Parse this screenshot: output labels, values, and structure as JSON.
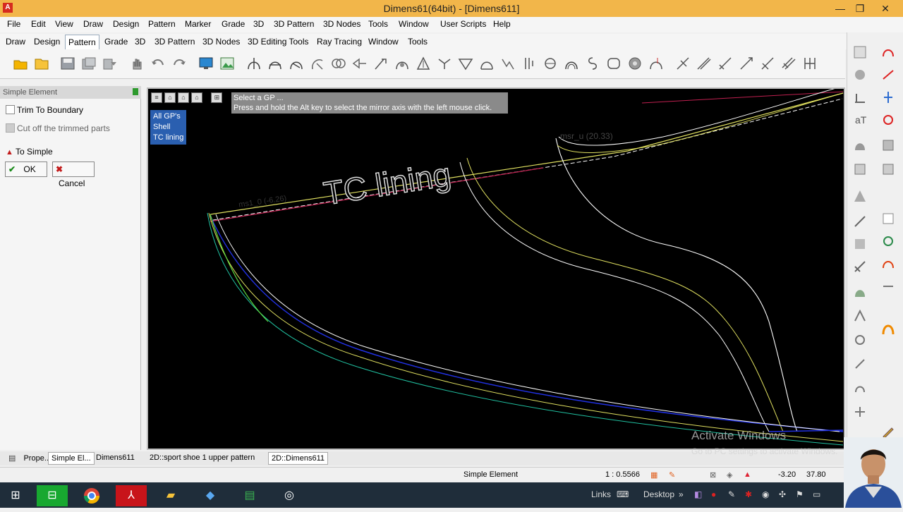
{
  "window": {
    "title": "Dimens61(64bit) - [Dimens611]",
    "min": "—",
    "max": "❐",
    "close": "✕"
  },
  "menu": [
    "File",
    "Edit",
    "View",
    "Draw",
    "Design",
    "Pattern",
    "Marker",
    "Grade",
    "3D",
    "3D Pattern",
    "3D Nodes",
    "Tools",
    "Window",
    "User Scripts",
    "Help"
  ],
  "tabs": [
    "Draw",
    "Design",
    "Pattern",
    "Grade",
    "3D",
    "3D Pattern",
    "3D Nodes",
    "3D Editing Tools",
    "Ray Tracing",
    "Window",
    "Tools"
  ],
  "active_tab": "Pattern",
  "panel": {
    "title": "Simple Element",
    "trim_label": "Trim To Boundary",
    "cut_label": "Cut off the trimmed parts",
    "to_simple": "To Simple",
    "ok": "OK",
    "cancel": "Cancel"
  },
  "canvas": {
    "gp_list": [
      "All GP's",
      "Shell",
      "TC lining"
    ],
    "prompt_line1": "Select a GP ...",
    "prompt_line2": "Press and hold the Alt key to select the mirror axis with the left mouse click.",
    "pattern_label": "TC lining",
    "ms1_label": "ms1_0 (-6.26)",
    "ms2_label": "msr_u (20.33)"
  },
  "bottom_tabs": [
    "Prope...",
    "Simple El...",
    "Dimens611",
    "2D::sport shoe 1 upper pattern",
    "2D::Dimens611"
  ],
  "bottom_active": "2D::Dimens611",
  "status": {
    "mode": "Simple Element",
    "scale": "1 : 0.5566",
    "x": "-3.20",
    "y": "37.80"
  },
  "watermark": {
    "line1": "Activate Windows",
    "line2": "Go to PC settings to activate Windows."
  },
  "taskbar": {
    "links": "Links",
    "desktop": "Desktop"
  }
}
